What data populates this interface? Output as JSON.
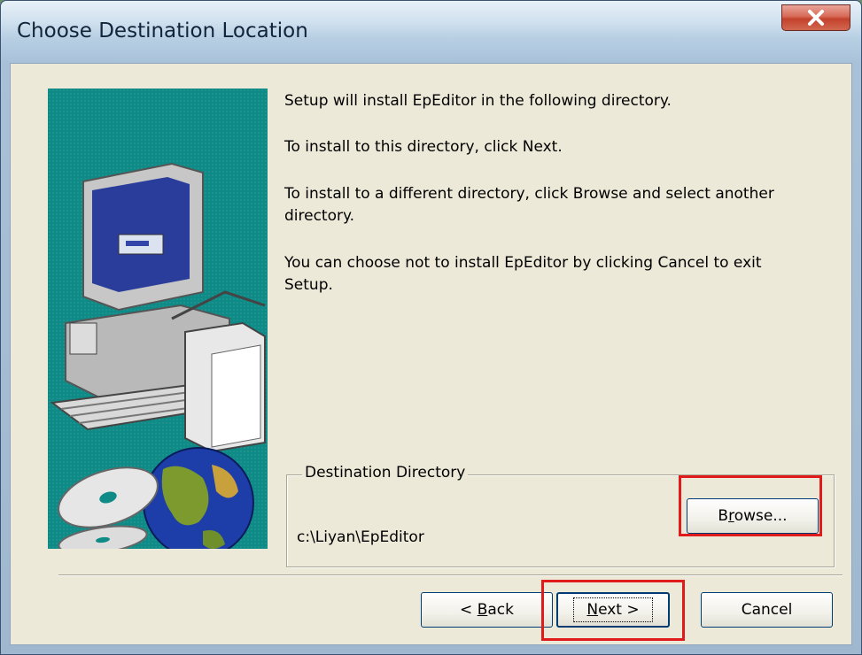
{
  "window": {
    "title": "Choose Destination Location",
    "close_glyph": "X"
  },
  "body_text": {
    "line1": "Setup will install EpEditor in the following directory.",
    "line2": "To install to this directory, click Next.",
    "line3a": "To install to a different directory, click Browse and select another",
    "line3b": "directory.",
    "line4a": "You can choose not to install EpEditor by clicking Cancel to exit",
    "line4b": "Setup."
  },
  "destination": {
    "legend": "Destination Directory",
    "path": "c:\\Liyan\\EpEditor",
    "browse_pre": "B",
    "browse_accel": "r",
    "browse_post": "owse..."
  },
  "buttons": {
    "back_pre": "< ",
    "back_accel": "B",
    "back_post": "ack",
    "next_accel": "N",
    "next_post": "ext >",
    "cancel": "Cancel"
  },
  "colors": {
    "highlight": "#e01b1b",
    "art_background": "#0e8a87",
    "dialog_face": "#ece9d8"
  },
  "icons": [
    "computer-illustration",
    "globe-icon",
    "cd-disc-icon",
    "close-icon"
  ]
}
